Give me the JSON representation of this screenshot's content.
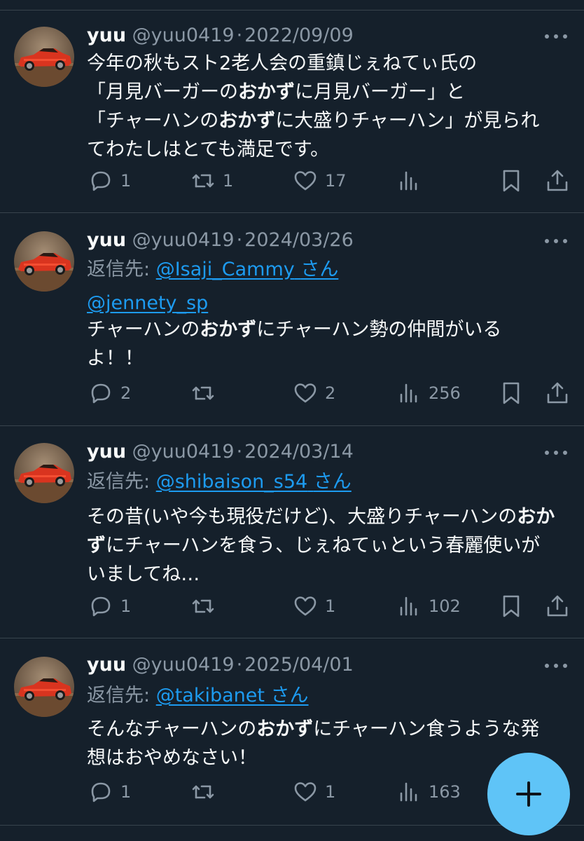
{
  "tweets": [
    {
      "name": "yuu",
      "handle": "@yuu0419",
      "sep": "·",
      "date": "2022/09/09",
      "reply_label": "",
      "reply_link": "",
      "reply_suffix": "",
      "mention": "",
      "lines": [
        [
          "今年の秋もスト2老人会の重鎮じぇねてぃ氏の"
        ],
        [
          "「月見バーガーの",
          "おかず",
          "に月見バーガー」と"
        ],
        [
          "「チャーハンの",
          "おかず",
          "に大盛りチャーハン」が見られ"
        ],
        [
          "てわたしはとても満足です。"
        ]
      ],
      "replies": "1",
      "retweets": "1",
      "likes": "17",
      "views": ""
    },
    {
      "name": "yuu",
      "handle": "@yuu0419",
      "sep": "·",
      "date": "2024/03/26",
      "reply_label": "返信先: ",
      "reply_link": "@Isaji_Cammy",
      "reply_suffix": "さん",
      "mention": "@jennety_sp",
      "lines": [
        [
          "チャーハンの",
          "おかず",
          "にチャーハン勢の仲間がいる"
        ],
        [
          "よ！！"
        ]
      ],
      "replies": "2",
      "retweets": "",
      "likes": "2",
      "views": "256"
    },
    {
      "name": "yuu",
      "handle": "@yuu0419",
      "sep": "·",
      "date": "2024/03/14",
      "reply_label": "返信先: ",
      "reply_link": "@shibaison_s54",
      "reply_suffix": "さん",
      "mention": "",
      "lines": [
        [
          "その昔(いや今も現役だけど)、大盛りチャーハンの",
          "おか"
        ],
        [
          "",
          "ず",
          "にチャーハンを食う、じぇねてぃという春麗使いが"
        ],
        [
          "いましてね…"
        ]
      ],
      "replies": "1",
      "retweets": "",
      "likes": "1",
      "views": "102"
    },
    {
      "name": "yuu",
      "handle": "@yuu0419",
      "sep": "·",
      "date": "2025/04/01",
      "reply_label": "返信先: ",
      "reply_link": "@takibanet",
      "reply_suffix": "さん",
      "mention": "",
      "lines": [
        [
          "そんなチャーハンの",
          "おかず",
          "にチャーハン食うような発"
        ],
        [
          "想はおやめなさい！"
        ]
      ],
      "replies": "1",
      "retweets": "",
      "likes": "1",
      "views": "163"
    }
  ],
  "colors": {
    "background": "#15202b",
    "text": "#f7f9f9",
    "muted": "#8b98a5",
    "link": "#1d9bf0",
    "divider": "#38444d",
    "fab": "#5fc4f7"
  },
  "icons": {
    "reply": "speech-bubble-icon",
    "retweet": "retweet-arrows-icon",
    "like": "heart-icon",
    "views": "bar-chart-icon",
    "bookmark": "bookmark-icon",
    "share": "share-upload-icon",
    "more": "three-dots-icon",
    "fab": "plus-icon"
  }
}
